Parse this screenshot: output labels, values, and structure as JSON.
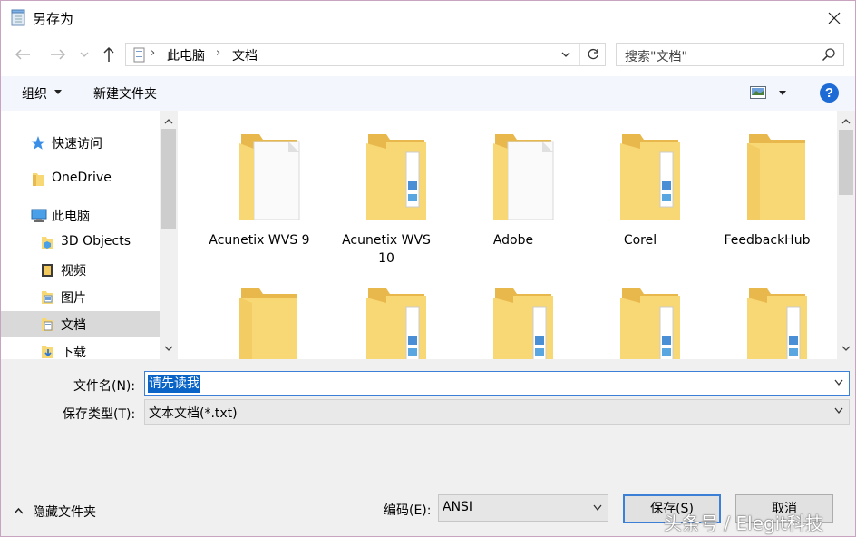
{
  "window": {
    "title": "另存为",
    "close_label": "×"
  },
  "address": {
    "crumbs": [
      "此电脑",
      "文档"
    ]
  },
  "search": {
    "placeholder": "搜索\"文档\""
  },
  "toolbar": {
    "organize": "组织",
    "new_folder": "新建文件夹",
    "help": "?"
  },
  "nav": {
    "items": [
      {
        "label": "快速访问",
        "icon": "star-icon"
      },
      {
        "label": "OneDrive",
        "icon": "onedrive-folder-icon"
      },
      {
        "label": "此电脑",
        "icon": "computer-icon"
      },
      {
        "label": "3D Objects",
        "icon": "3d-objects-icon"
      },
      {
        "label": "视频",
        "icon": "videos-icon"
      },
      {
        "label": "图片",
        "icon": "pictures-icon"
      },
      {
        "label": "文档",
        "icon": "documents-icon"
      },
      {
        "label": "下载",
        "icon": "downloads-icon"
      }
    ],
    "selected": "文档"
  },
  "files": [
    {
      "name": "Acunetix WVS 9",
      "icon": "folder-with-document-icon"
    },
    {
      "name": "Acunetix WVS\n10",
      "icon": "folder-with-files-icon"
    },
    {
      "name": "Adobe",
      "icon": "folder-with-document-icon"
    },
    {
      "name": "Corel",
      "icon": "folder-with-files-icon"
    },
    {
      "name": "FeedbackHub",
      "icon": "folder-icon"
    },
    {
      "name": "",
      "icon": "folder-icon"
    },
    {
      "name": "",
      "icon": "folder-with-files-icon"
    },
    {
      "name": "",
      "icon": "folder-with-files-icon"
    },
    {
      "name": "",
      "icon": "folder-with-files-icon"
    },
    {
      "name": "",
      "icon": "folder-with-files-icon"
    }
  ],
  "form": {
    "filename_label": "文件名(N):",
    "filename_value": "请先读我",
    "filetype_label": "保存类型(T):",
    "filetype_value": "文本文档(*.txt)",
    "hide_folders": "隐藏文件夹",
    "encoding_label": "编码(E):",
    "encoding_value": "ANSI",
    "save": "保存(S)",
    "cancel": "取消"
  },
  "watermark": "头条号 / Elegit科技",
  "colors": {
    "accent": "#3c7fd6",
    "selection": "#0a64c8",
    "folder": "#f8d775",
    "toolbar_bg": "#f3f6fc",
    "form_bg": "#f0f0f0"
  }
}
